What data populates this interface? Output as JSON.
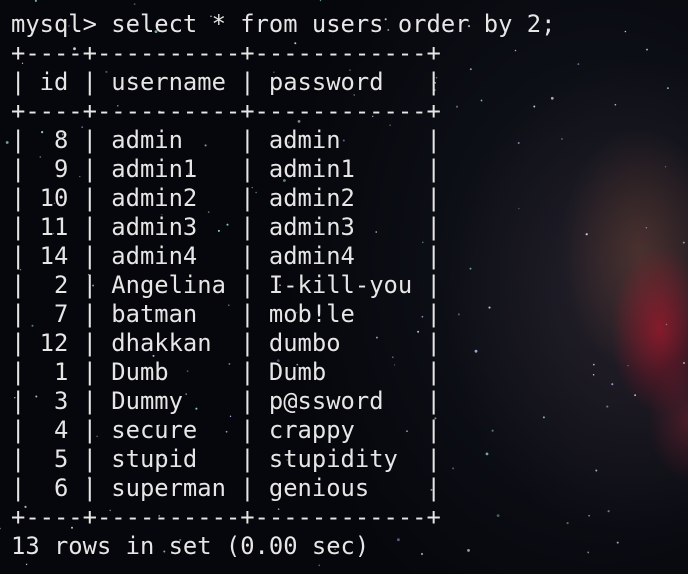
{
  "prompt": "mysql>",
  "command": "select * from users order by 2;",
  "table": {
    "columns": [
      "id",
      "username",
      "password"
    ],
    "rows": [
      [
        "8",
        "admin",
        "admin"
      ],
      [
        "9",
        "admin1",
        "admin1"
      ],
      [
        "10",
        "admin2",
        "admin2"
      ],
      [
        "11",
        "admin3",
        "admin3"
      ],
      [
        "14",
        "admin4",
        "admin4"
      ],
      [
        "2",
        "Angelina",
        "I-kill-you"
      ],
      [
        "7",
        "batman",
        "mob!le"
      ],
      [
        "12",
        "dhakkan",
        "dumbo"
      ],
      [
        "1",
        "Dumb",
        "Dumb"
      ],
      [
        "3",
        "Dummy",
        "p@ssword"
      ],
      [
        "4",
        "secure",
        "crappy"
      ],
      [
        "5",
        "stupid",
        "stupidity"
      ],
      [
        "6",
        "superman",
        "genious"
      ]
    ]
  },
  "result_summary": "13 rows in set (0.00 sec)",
  "colors": {
    "text": "#e6e6e6",
    "background": "#06070c"
  }
}
